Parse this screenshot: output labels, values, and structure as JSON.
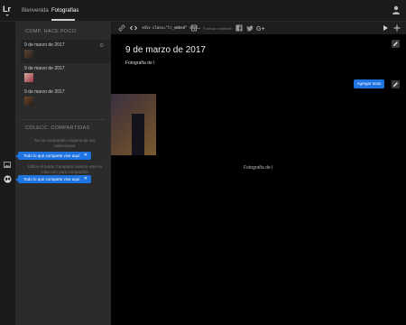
{
  "app": {
    "logo_text": "Lr"
  },
  "nav": {
    "tabs": [
      {
        "label": "Bienvenida"
      },
      {
        "label": "Fotografías"
      }
    ]
  },
  "sidebar": {
    "recent_header": "COMP. HACE POCO",
    "items": [
      {
        "date": "9 de marzo de 2017"
      },
      {
        "date": "9 de marzo de 2017"
      },
      {
        "date": "9 de marzo de 2017"
      }
    ],
    "shared_header": "COLECC. COMPARTIDAS",
    "no_shared_text": "No ha compartido ninguna de sus colecciones.",
    "hint_text": "Utilice el botón Compartir cuando esté en colección para compartirla."
  },
  "tooltips": {
    "shared_here_1": "Todo lo que comparte vive aquí",
    "shared_here_2": "Todo lo que comparte vive aquí"
  },
  "toolbar": {
    "embed_code": "<div class=\"lr_embed\" styl…",
    "publish_label": "Publicar mediante"
  },
  "main": {
    "title": "9 de marzo de 2017",
    "subtitle": "Fotografía de I",
    "add_text_button": "Agregar texto",
    "photo_caption": "Fotografía de I"
  },
  "colors": {
    "accent": "#1f73e0",
    "sidebar_bg": "#2b2b2b",
    "main_bg": "#000000"
  }
}
